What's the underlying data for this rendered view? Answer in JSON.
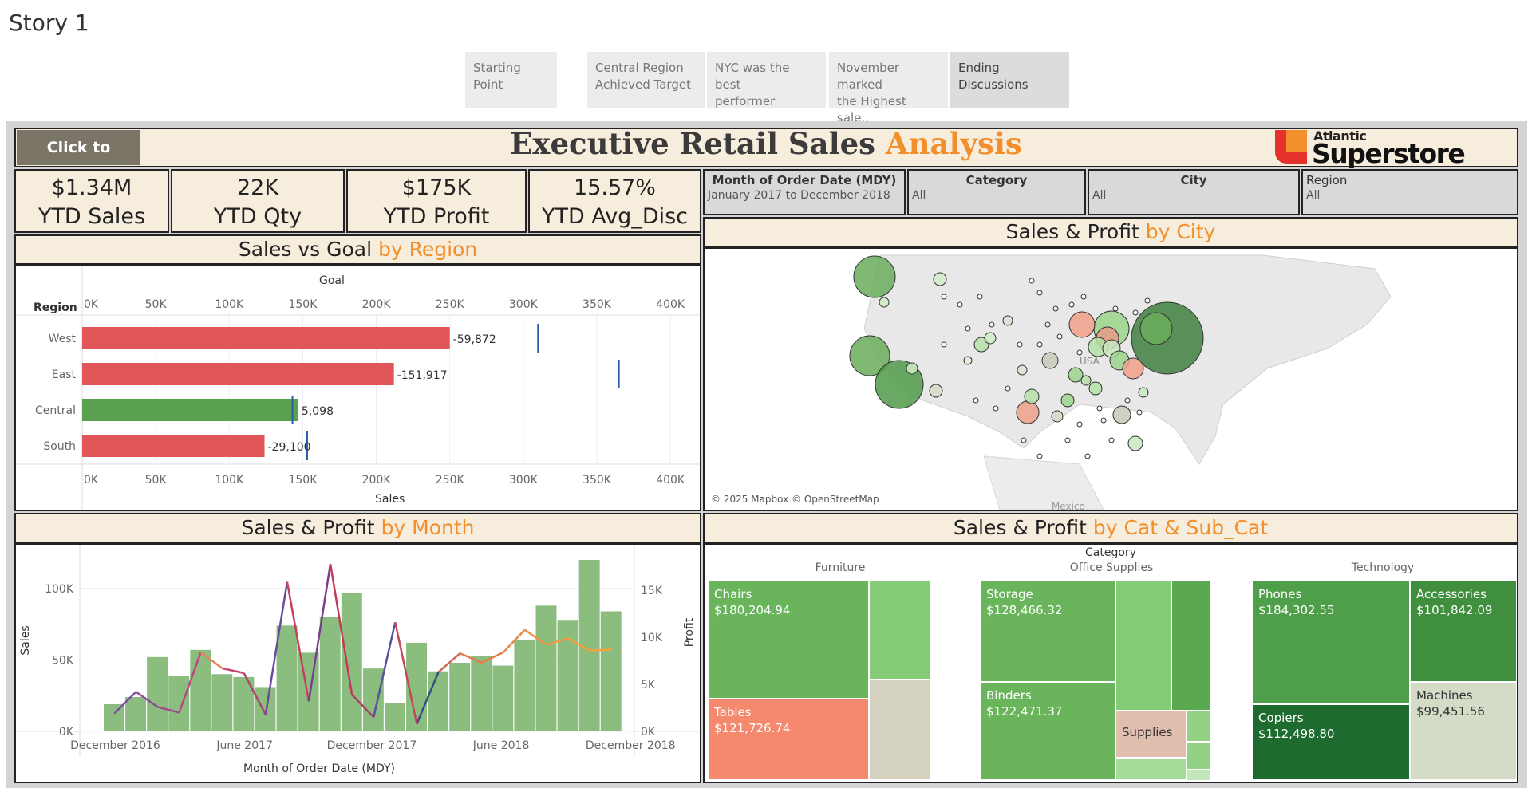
{
  "story": {
    "title": "Story 1"
  },
  "story_points": [
    {
      "label_line1": "Starting Point",
      "label_line2": ""
    },
    {
      "label_line1": "Central Region",
      "label_line2": "Achieved Target"
    },
    {
      "label_line1": "NYC was the best",
      "label_line2": "performer"
    },
    {
      "label_line1": "November marked",
      "label_line2": "the  Highest sale.."
    },
    {
      "label_line1": "Ending",
      "label_line2": "Discussions"
    }
  ],
  "dashboard": {
    "click_label": "Click to",
    "title_main": "Executive Retail Sales ",
    "title_accent": "Analysis",
    "logo_small": "Atlantic",
    "logo_big": "Superstore"
  },
  "kpis": [
    {
      "value": "$1.34M",
      "label": "YTD Sales"
    },
    {
      "value": "22K",
      "label": "YTD Qty"
    },
    {
      "value": "$175K",
      "label": "YTD Profit"
    },
    {
      "value": "15.57%",
      "label": "YTD Avg_Disc"
    }
  ],
  "filters": [
    {
      "label": "Month of Order Date (MDY)",
      "value": "January 2017 to December 2018"
    },
    {
      "label": "Category",
      "value": "All"
    },
    {
      "label": "City",
      "value": "All"
    },
    {
      "label": "Region",
      "value": "All"
    }
  ],
  "panels": {
    "region": {
      "title": "Sales vs Goal ",
      "accent": "by Region"
    },
    "city": {
      "title": "Sales & Profit ",
      "accent": "by City",
      "attribution": "© 2025 Mapbox © OpenStreetMap",
      "usa_label": "USA",
      "mexico_label": "Mexico"
    },
    "month": {
      "title": "Sales & Profit ",
      "accent": "by Month"
    },
    "category": {
      "title": "Sales & Profit ",
      "accent": "by Cat & Sub_Cat"
    }
  },
  "colors": {
    "accent": "#f28e2b",
    "negative": "#e15759",
    "positive": "#59a14f",
    "header_bg": "#f6eddc"
  },
  "chart_data": [
    {
      "type": "bar",
      "title": "Sales vs Goal by Region",
      "top_axis_label": "Goal",
      "xlabel": "Sales",
      "ylabel": "Region",
      "categories": [
        "West",
        "East",
        "Central",
        "South"
      ],
      "series": [
        {
          "name": "Sales",
          "values": [
            250000,
            212000,
            147000,
            124000
          ]
        },
        {
          "name": "Goal",
          "values": [
            310000,
            365000,
            143000,
            153000
          ]
        }
      ],
      "difference_labels": [
        "-59,872",
        "-151,917",
        "5,098",
        "-29,100"
      ],
      "xlim": [
        0,
        420000
      ],
      "tick_labels": [
        "0K",
        "50K",
        "100K",
        "150K",
        "200K",
        "250K",
        "300K",
        "350K",
        "400K"
      ]
    },
    {
      "type": "bar",
      "title": "Sales & Profit by Month",
      "xlabel": "Month of Order Date (MDY)",
      "ylabel": "Sales",
      "y2label": "Profit",
      "x_tick_labels": [
        "December 2016",
        "June 2017",
        "December 2017",
        "June 2018",
        "December 2018"
      ],
      "y_tick_labels": [
        "0K",
        "50K",
        "100K"
      ],
      "y2_tick_labels": [
        "0K",
        "5K",
        "10K",
        "15K"
      ],
      "ylim": [
        0,
        125000
      ],
      "y2lim": [
        0,
        19000
      ],
      "series": [
        {
          "name": "Sales",
          "values": [
            19000,
            24000,
            52000,
            39000,
            57000,
            40000,
            38000,
            31000,
            74000,
            55000,
            80000,
            97000,
            44000,
            20000,
            62000,
            42000,
            48000,
            53000,
            46000,
            64000,
            88000,
            78000,
            120000,
            84000
          ]
        },
        {
          "name": "Profit",
          "values": [
            1900,
            4200,
            2600,
            2000,
            8400,
            6700,
            6200,
            1800,
            15900,
            3200,
            17800,
            3900,
            1500,
            11600,
            800,
            6300,
            8300,
            7300,
            8400,
            10800,
            9200,
            9900,
            8600,
            8700
          ]
        }
      ]
    },
    {
      "type": "treemap",
      "title": "Sales & Profit by Cat & Sub_Cat",
      "group_label": "Category",
      "categories": [
        "Furniture",
        "Office Supplies",
        "Technology"
      ],
      "labeled_items": [
        {
          "category": "Furniture",
          "sub_category": "Chairs",
          "value": "$180,204.94"
        },
        {
          "category": "Furniture",
          "sub_category": "Tables",
          "value": "$121,726.74"
        },
        {
          "category": "Office Supplies",
          "sub_category": "Storage",
          "value": "$128,466.32"
        },
        {
          "category": "Office Supplies",
          "sub_category": "Binders",
          "value": "$122,471.37"
        },
        {
          "category": "Office Supplies",
          "sub_category": "Supplies",
          "value": ""
        },
        {
          "category": "Technology",
          "sub_category": "Phones",
          "value": "$184,302.55"
        },
        {
          "category": "Technology",
          "sub_category": "Accessories",
          "value": "$101,842.09"
        },
        {
          "category": "Technology",
          "sub_category": "Copiers",
          "value": "$112,498.80"
        },
        {
          "category": "Technology",
          "sub_category": "Machines",
          "value": "$99,451.56"
        }
      ]
    }
  ]
}
